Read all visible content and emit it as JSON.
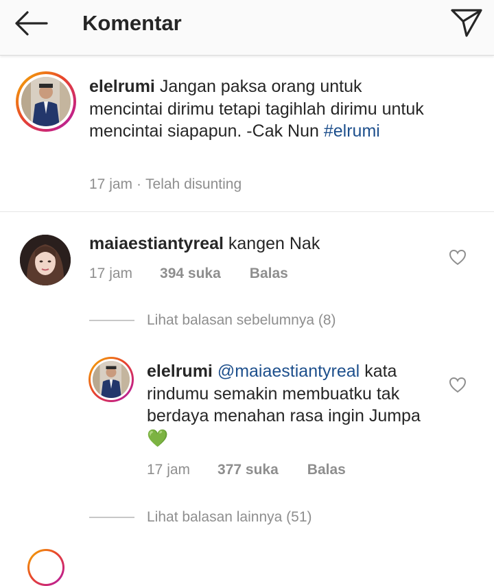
{
  "header": {
    "title": "Komentar",
    "back_icon": "arrow-left-icon",
    "send_icon": "paper-plane-icon"
  },
  "caption": {
    "username": "elelrumi",
    "text": "Jangan paksa orang untuk mencintai dirimu tetapi tagihlah dirimu untuk mencintai siapapun. -Cak Nun",
    "hashtag": "#elrumi",
    "time": "17 jam",
    "separator": "·",
    "edited": "Telah disunting"
  },
  "comments": [
    {
      "username": "maiaestiantyreal",
      "text": "kangen Nak",
      "time": "17 jam",
      "likes": "394 suka",
      "reply": "Balas",
      "view_replies": "Lihat balasan sebelumnya (8)",
      "replies": [
        {
          "username": "elelrumi",
          "mention": "@maiaestiantyreal",
          "text": "kata rindumu semakin membuatku tak berdaya menahan rasa ingin Jumpa",
          "emoji": "💚",
          "time": "17 jam",
          "likes": "377 suka",
          "reply": "Balas"
        }
      ],
      "more_replies": "Lihat balasan lainnya (51)"
    }
  ]
}
